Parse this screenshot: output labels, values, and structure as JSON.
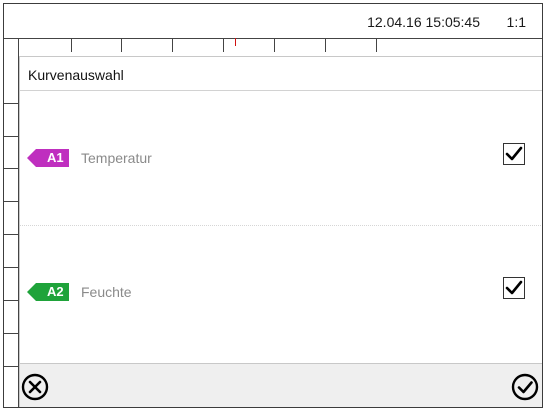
{
  "status": {
    "datetime": "12.04.16 15:05:45",
    "ratio": "1:1"
  },
  "dialog": {
    "title": "Kurvenauswahl",
    "items": [
      {
        "tag": "A1",
        "label": "Temperatur",
        "checked": true,
        "color": "#bf2fbf"
      },
      {
        "tag": "A2",
        "label": "Feuchte",
        "checked": true,
        "color": "#1fa33a"
      }
    ]
  },
  "footer": {
    "cancel_icon": "circle-x-icon",
    "confirm_icon": "circle-check-icon"
  }
}
